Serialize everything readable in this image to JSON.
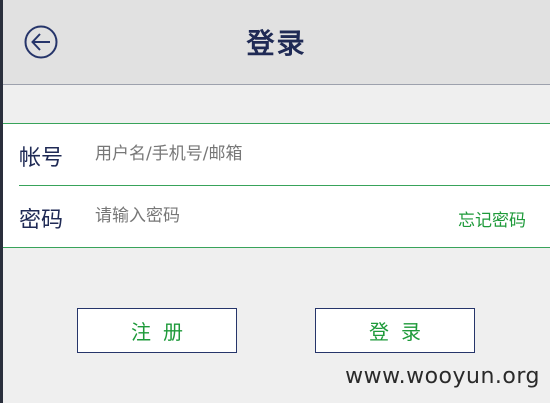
{
  "header": {
    "title": "登录",
    "back_icon": "back-arrow-circle-icon"
  },
  "form": {
    "account": {
      "label": "帐号",
      "placeholder": "用户名/手机号/邮箱",
      "value": ""
    },
    "password": {
      "label": "密码",
      "placeholder": "请输入密码",
      "value": "",
      "forgot_label": "忘记密码"
    }
  },
  "actions": {
    "register_label": "注册",
    "login_label": "登录"
  },
  "watermark": "www.wooyun.org",
  "colors": {
    "title": "#1f2a55",
    "accent_green": "#1e9a3a",
    "divider_green": "#38a35a",
    "header_bg": "#e1e1e1",
    "page_bg": "#efefef"
  }
}
